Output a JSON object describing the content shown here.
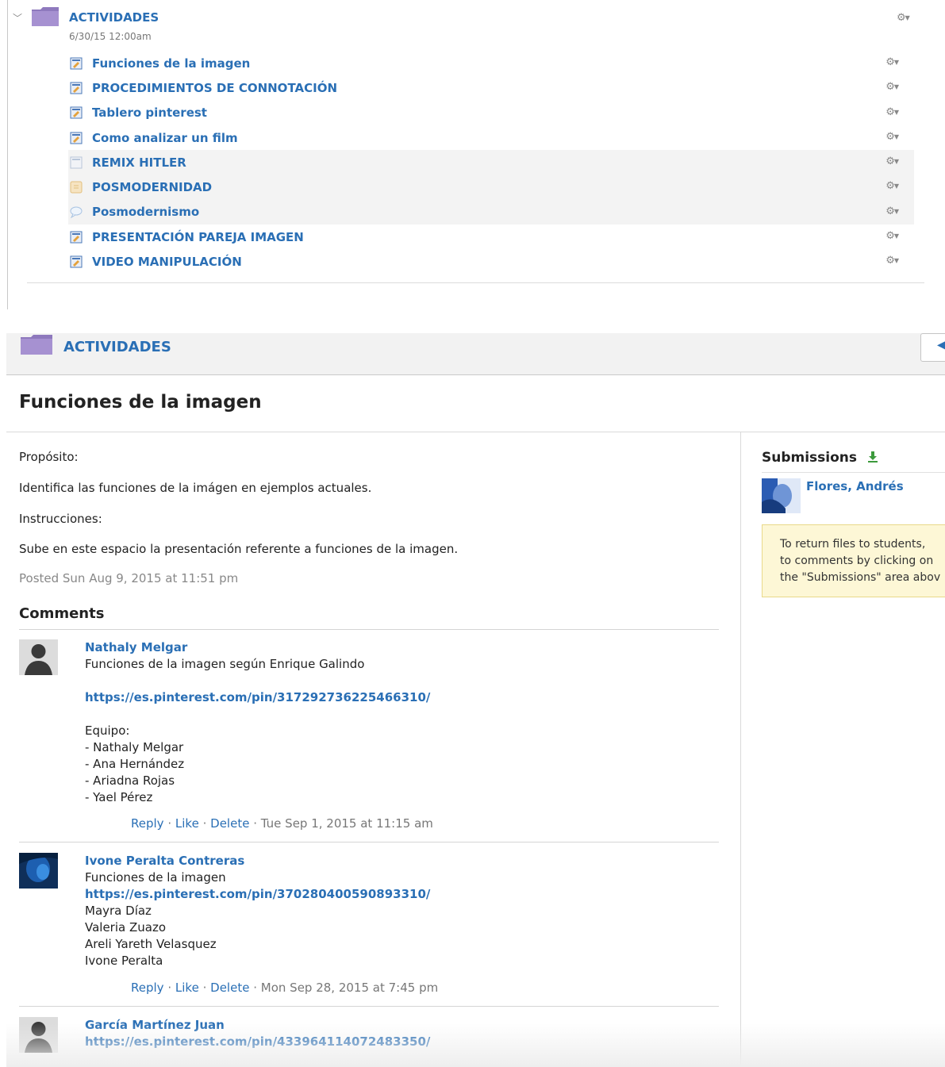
{
  "module": {
    "title": "ACTIVIDADES",
    "date": "6/30/15 12:00am",
    "items": [
      {
        "label": "Funciones de la imagen",
        "icon": "assignment-icon",
        "shaded": false
      },
      {
        "label": "PROCEDIMIENTOS DE CONNOTACIÓN",
        "icon": "assignment-icon",
        "shaded": false
      },
      {
        "label": "Tablero pinterest",
        "icon": "assignment-icon",
        "shaded": false
      },
      {
        "label": "Como analizar un film",
        "icon": "assignment-icon",
        "shaded": false
      },
      {
        "label": "REMIX HITLER",
        "icon": "assignment-icon",
        "shaded": true
      },
      {
        "label": "POSMODERNIDAD",
        "icon": "quiz-icon",
        "shaded": true
      },
      {
        "label": "Posmodernismo",
        "icon": "discussion-icon",
        "shaded": true
      },
      {
        "label": "PRESENTACIÓN PAREJA IMAGEN",
        "icon": "assignment-icon",
        "shaded": false
      },
      {
        "label": "VIDEO MANIPULACIÓN",
        "icon": "assignment-icon",
        "shaded": false
      }
    ]
  },
  "header": {
    "module_title": "ACTIVIDADES",
    "back_label": "◀"
  },
  "assignment": {
    "title": "Funciones de la imagen",
    "body": [
      "Propósito:",
      "Identifica las funciones de la imágen en ejemplos actuales.",
      "Instrucciones:",
      "Sube en este espacio la presentación referente a funciones de la imagen."
    ],
    "posted": "Posted Sun Aug 9, 2015 at 11:51 pm"
  },
  "comments": {
    "heading": "Comments",
    "actions": {
      "reply": "Reply",
      "like": "Like",
      "delete": "Delete",
      "sep": "·"
    },
    "list": [
      {
        "author": "Nathaly Melgar",
        "line1": "Funciones de la imagen según Enrique Galindo",
        "link": "https://es.pinterest.com/pin/317292736225466310/",
        "team_label": "Equipo:",
        "members": [
          "- Nathaly Melgar",
          "- Ana Hernández",
          "- Ariadna Rojas",
          "- Yael Pérez"
        ],
        "date": "Tue Sep 1, 2015 at 11:15 am"
      },
      {
        "author": "Ivone Peralta Contreras",
        "line1": "Funciones de la imagen",
        "link": "https://es.pinterest.com/pin/370280400590893310/",
        "members": [
          "Mayra Díaz",
          "Valeria Zuazo",
          "Areli Yareth Velasquez",
          "Ivone Peralta"
        ],
        "date": "Mon Sep 28, 2015 at 7:45 pm"
      },
      {
        "author": "García Martínez Juan",
        "link": "https://es.pinterest.com/pin/433964114072483350/"
      }
    ]
  },
  "submissions": {
    "title": "Submissions",
    "student": "Flores, Andrés",
    "note_lines": [
      "To return files to students,",
      "to comments by clicking on",
      "the \"Submissions\" area abov"
    ]
  },
  "colors": {
    "link": "#2a6fb5",
    "folder": "#9b84c4",
    "note_bg": "#fdf7d6"
  }
}
